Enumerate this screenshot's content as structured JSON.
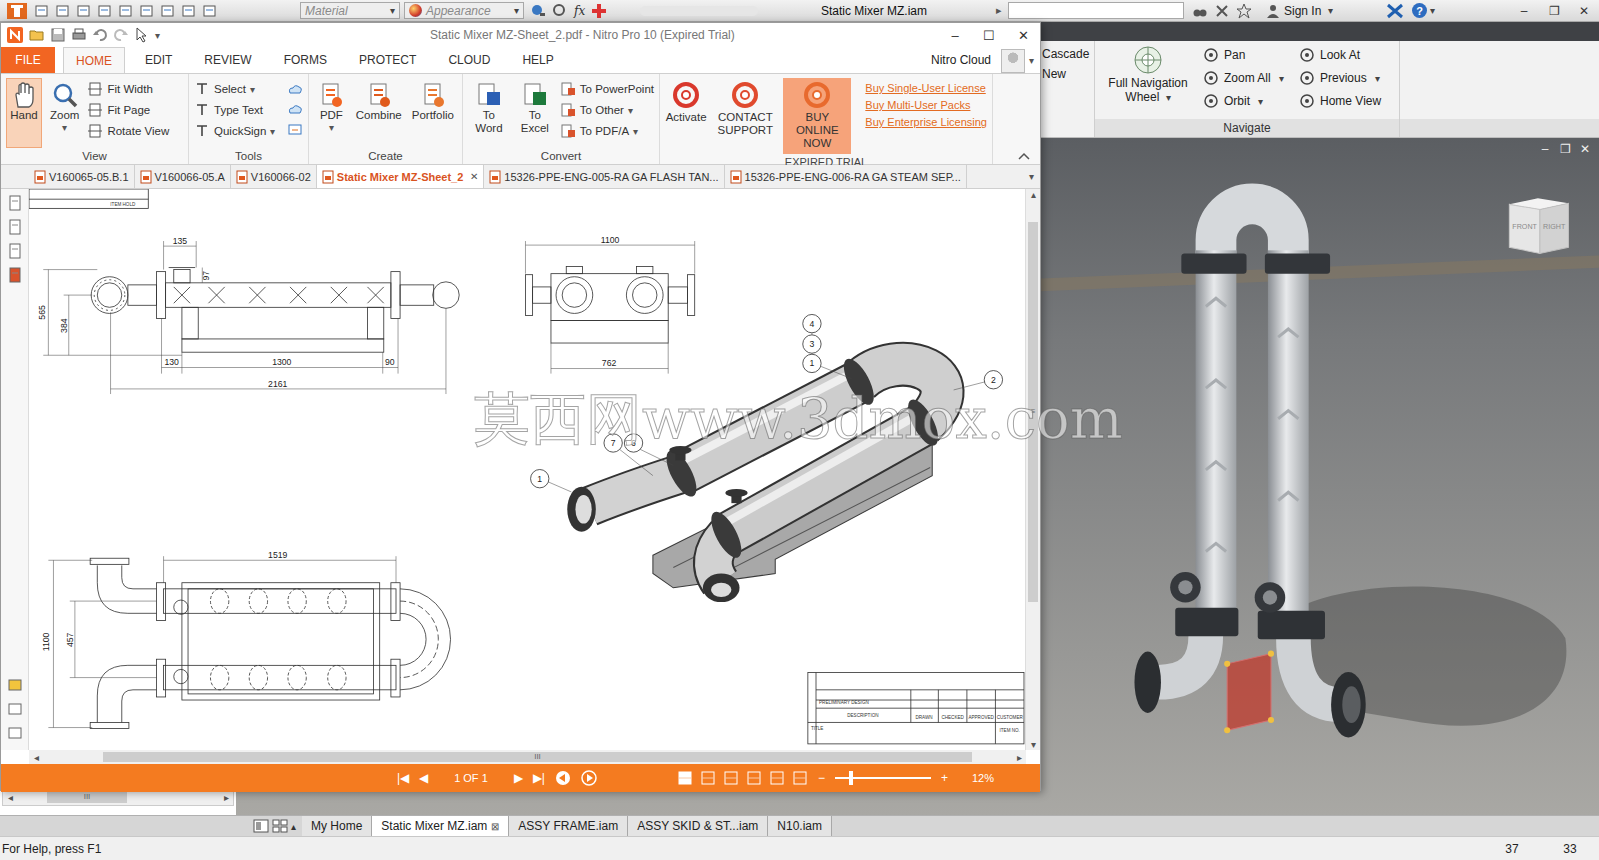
{
  "inventor": {
    "quick_access": {
      "material": "Material",
      "appearance": "Appearance",
      "fx": "fx",
      "title": "Static Mixer MZ.iam",
      "more": "▸",
      "sign_in": "Sign In",
      "help": "?",
      "caret": "▾",
      "controls": [
        "–",
        "❐",
        "✕"
      ]
    },
    "ribbon": {
      "window_items": [
        "Cascade",
        "New"
      ],
      "navigate": {
        "label": "Navigate",
        "wheel": "Full Navigation Wheel",
        "columns": [
          [
            {
              "label": "Pan",
              "dropdown": false
            },
            {
              "label": "Zoom All",
              "dropdown": true
            },
            {
              "label": "Orbit",
              "dropdown": true
            }
          ],
          [
            {
              "label": "Look At",
              "dropdown": false
            },
            {
              "label": "Previous",
              "dropdown": true
            },
            {
              "label": "Home View",
              "dropdown": false
            }
          ]
        ]
      }
    },
    "viewport": {
      "viewcube": [
        "FRONT",
        "RIGHT"
      ],
      "controls": [
        "–",
        "❐",
        "✕"
      ]
    },
    "browser_scroll": {
      "left": "◂",
      "right": "▸",
      "grip": "III"
    },
    "doc_tabs_toggle": "▴",
    "close_glyph": "⊠",
    "doc_tabs": [
      {
        "label": "My Home",
        "selected": false,
        "closable": false
      },
      {
        "label": "Static Mixer MZ.iam",
        "selected": true,
        "closable": true
      },
      {
        "label": "ASSY FRAME.iam",
        "selected": false,
        "closable": false
      },
      {
        "label": "ASSY SKID & ST...iam",
        "selected": false,
        "closable": false
      },
      {
        "label": "N10.iam",
        "selected": false,
        "closable": false
      }
    ],
    "status": {
      "help": "For Help, press F1",
      "counts": [
        "37",
        "33"
      ]
    }
  },
  "nitro": {
    "title": "Static Mixer MZ-Sheet_2.pdf - Nitro Pro 10 (Expired Trial)",
    "controls": [
      "–",
      "☐",
      "✕"
    ],
    "caret": "▾",
    "menu": [
      {
        "label": "FILE",
        "selected": false,
        "kind": "file"
      },
      {
        "label": "HOME",
        "selected": true,
        "kind": "tab"
      },
      {
        "label": "EDIT",
        "selected": false,
        "kind": "tab"
      },
      {
        "label": "REVIEW",
        "selected": false,
        "kind": "tab"
      },
      {
        "label": "FORMS",
        "selected": false,
        "kind": "tab"
      },
      {
        "label": "PROTECT",
        "selected": false,
        "kind": "tab"
      },
      {
        "label": "CLOUD",
        "selected": false,
        "kind": "tab"
      },
      {
        "label": "HELP",
        "selected": false,
        "kind": "tab"
      }
    ],
    "cloud": "Nitro Cloud",
    "ribbon": {
      "view": {
        "label": "View",
        "hand": {
          "label": "Hand",
          "selected": true
        },
        "zoom": {
          "label": "Zoom",
          "dropdown": true
        },
        "small": [
          "Fit Width",
          "Fit Page",
          "Rotate View"
        ]
      },
      "tools": {
        "label": "Tools",
        "small": [
          {
            "label": "Select",
            "dropdown": true
          },
          {
            "label": "Type Text",
            "dropdown": false
          },
          {
            "label": "QuickSign",
            "dropdown": true
          }
        ]
      },
      "create": {
        "label": "Create",
        "big": [
          {
            "label": "PDF",
            "dropdown": true
          },
          {
            "label": "Combine",
            "dropdown": false
          },
          {
            "label": "Portfolio",
            "dropdown": false
          }
        ]
      },
      "convert": {
        "label": "Convert",
        "big": [
          "To Word",
          "To Excel"
        ],
        "small": [
          {
            "label": "To PowerPoint",
            "dropdown": false
          },
          {
            "label": "To Other",
            "dropdown": true
          },
          {
            "label": "To PDF/A",
            "dropdown": true
          }
        ]
      },
      "trial": {
        "label": "EXPIRED TRIAL",
        "big": [
          {
            "label": "Activate",
            "selected": false
          },
          {
            "label": "CONTACT SUPPORT",
            "selected": false
          },
          {
            "label": "BUY ONLINE NOW",
            "selected": true
          }
        ],
        "links": [
          "Buy Single-User License",
          "Buy Multi-User Packs",
          "Buy Enterprise Licensing"
        ]
      }
    },
    "doc_tabs": [
      {
        "label": "V160065-05.B.1",
        "selected": false
      },
      {
        "label": "V160066-05.A",
        "selected": false
      },
      {
        "label": "V160066-02",
        "selected": false
      },
      {
        "label": "Static Mixer MZ-Sheet_2",
        "selected": true
      },
      {
        "label": "15326-PPE-ENG-005-RA GA FLASH TAN...",
        "selected": false
      },
      {
        "label": "15326-PPE-ENG-006-RA GA STEAM SEP...",
        "selected": false
      }
    ],
    "tab_close": "✕",
    "tabs_menu": "▾",
    "scroll": {
      "left": "◂",
      "right": "▸",
      "up": "▴",
      "down": "▾",
      "grip": "III",
      "vgrip": "≡"
    },
    "status": {
      "nav": [
        "|◀",
        "◀",
        "▶",
        "▶|"
      ],
      "page": "1 OF 1",
      "zoom_minus": "−",
      "zoom_plus": "+",
      "zoom_level": 0.17,
      "zoom": "12%"
    },
    "drawing": {
      "corner": "ITEM HOLD",
      "dims": [
        "135",
        "97",
        "565",
        "384",
        "130",
        "1300",
        "90",
        "2161",
        "1100",
        "762",
        "1519",
        "1100",
        "457"
      ],
      "balloons": [
        "4",
        "3",
        "1",
        "2",
        "7",
        "6",
        "1"
      ],
      "title_block": [
        "PRELIMINARY DESIGN",
        "DESCRIPTION",
        "DRAWN",
        "CHECKED",
        "APPROVED",
        "CUSTOMER",
        "TITLE",
        "ITEM NO."
      ]
    }
  },
  "watermark": "莫西网www.3dmox.com"
}
